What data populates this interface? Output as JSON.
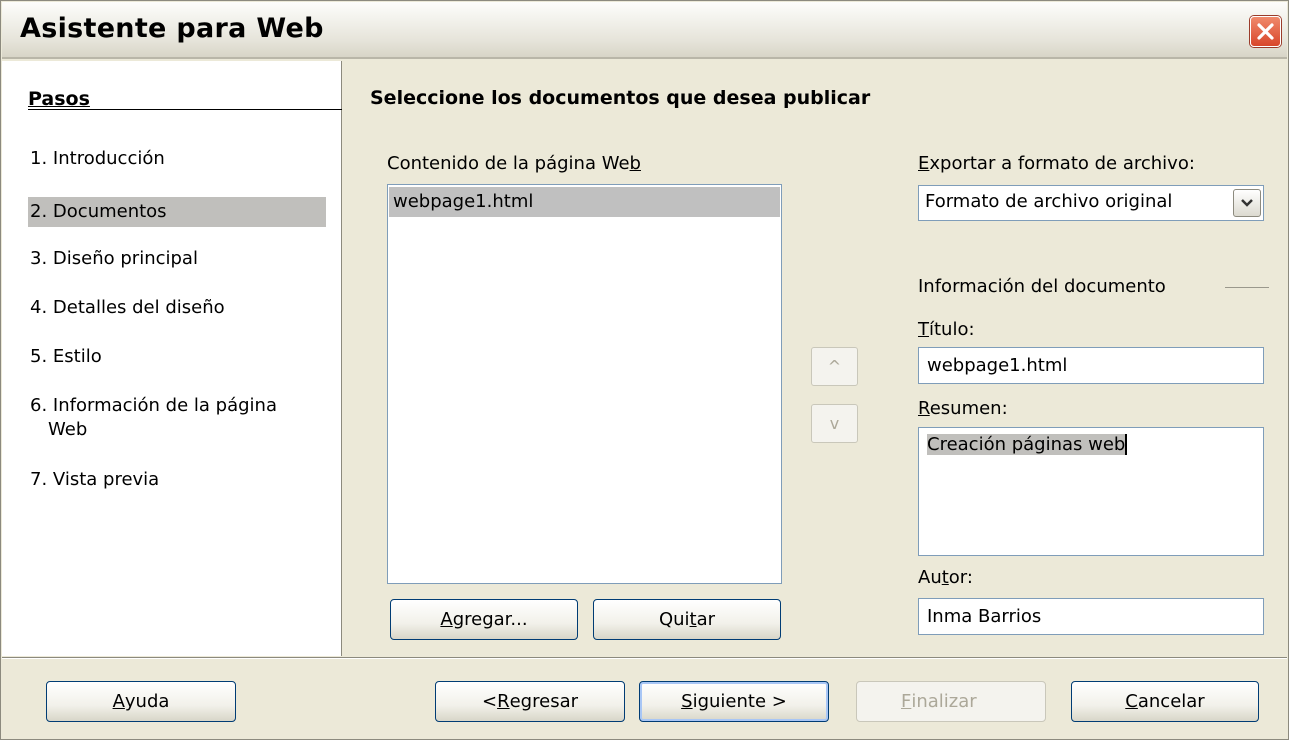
{
  "window": {
    "title": "Asistente para Web"
  },
  "steps": {
    "header": "Pasos",
    "items": [
      {
        "num": "1.",
        "label": "Introducción"
      },
      {
        "num": "2.",
        "label": "Documentos"
      },
      {
        "num": "3.",
        "label": "Diseño principal"
      },
      {
        "num": "4.",
        "label": "Detalles del diseño"
      },
      {
        "num": "5.",
        "label": "Estilo"
      },
      {
        "num": "6.",
        "label": "Información de la página",
        "label2": "Web"
      },
      {
        "num": "7.",
        "label": "Vista previa"
      }
    ],
    "active": "2. Documentos"
  },
  "main": {
    "heading": "Seleccione los documentos que desea publicar",
    "content_label_pre": "Contenido de la página We",
    "content_label_key": "b",
    "content_items": [
      "webpage1.html"
    ],
    "add_button_key": "A",
    "add_button_rest": "gregar...",
    "remove_button_pre": "Qui",
    "remove_button_key": "t",
    "remove_button_rest": "ar",
    "move_up": "^",
    "move_down": "v",
    "export_label_key": "E",
    "export_label_rest": "xportar a formato de archivo:",
    "export_value": "Formato de archivo original",
    "doc_info_label": "Información del documento",
    "title_label_key": "T",
    "title_label_rest": "ítulo:",
    "title_value": "webpage1.html",
    "summary_label_key": "R",
    "summary_label_rest": "esumen:",
    "summary_value": "Creación páginas web",
    "author_label_pre": "Au",
    "author_label_key": "t",
    "author_label_rest": "or:",
    "author_value": "Inma Barrios"
  },
  "footer": {
    "help_key": "A",
    "help_rest": "yuda",
    "back_pre": "< ",
    "back_key": "R",
    "back_rest": "egresar",
    "next_key": "S",
    "next_rest": "iguiente >",
    "finish_key": "F",
    "finish_rest": "inalizar",
    "cancel_key": "C",
    "cancel_rest": "ancelar"
  },
  "colors": {
    "background": "#ece9d8",
    "selection": "#c0bfbc",
    "close": "#d8462b"
  }
}
